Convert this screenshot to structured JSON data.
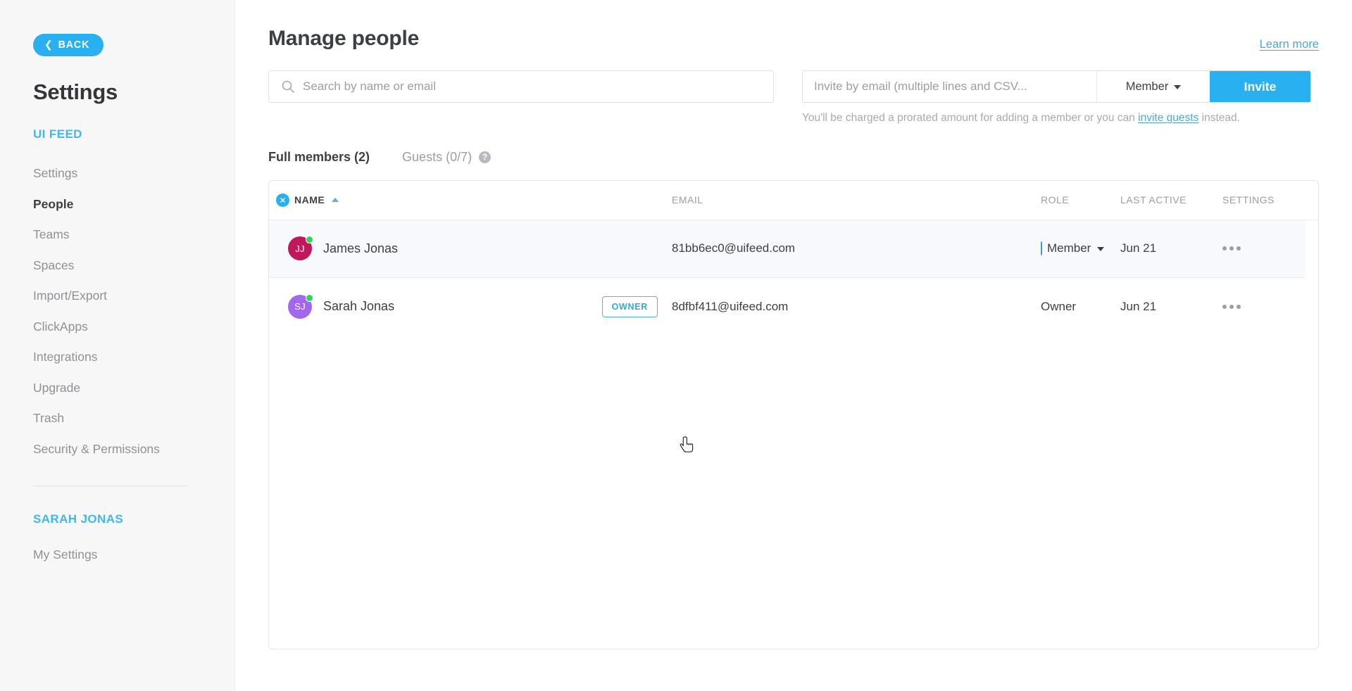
{
  "sidebar": {
    "back_label": "BACK",
    "back_icon": "chevron-left-icon",
    "title": "Settings",
    "workspace_label": "UI FEED",
    "items": [
      {
        "label": "Settings",
        "active": false
      },
      {
        "label": "People",
        "active": true
      },
      {
        "label": "Teams",
        "active": false
      },
      {
        "label": "Spaces",
        "active": false
      },
      {
        "label": "Import/Export",
        "active": false
      },
      {
        "label": "ClickApps",
        "active": false
      },
      {
        "label": "Integrations",
        "active": false
      },
      {
        "label": "Upgrade",
        "active": false
      },
      {
        "label": "Trash",
        "active": false
      },
      {
        "label": "Security & Permissions",
        "active": false
      }
    ],
    "user_label": "SARAH JONAS",
    "my_settings_label": "My Settings"
  },
  "header": {
    "title": "Manage people",
    "learn_more_label": "Learn more"
  },
  "search": {
    "placeholder": "Search by name or email",
    "value": "",
    "icon": "search-icon"
  },
  "invite": {
    "placeholder": "Invite by email (multiple lines and CSV...",
    "value": "",
    "role_label": "Member",
    "button_label": "Invite",
    "note_prefix": "You'll be charged a prorated amount for adding a member or you can ",
    "note_link": "invite guests",
    "note_suffix": " instead."
  },
  "tabs": [
    {
      "label": "Full members (2)",
      "active": true
    },
    {
      "label": "Guests (0/7)",
      "active": false,
      "help_icon": "question-mark-icon"
    }
  ],
  "table": {
    "columns": {
      "name": "NAME",
      "email": "EMAIL",
      "role": "ROLE",
      "last_active": "LAST ACTIVE",
      "settings": "SETTINGS"
    },
    "sort": {
      "column": "NAME",
      "direction": "asc",
      "clear_icon": "close-circle-icon"
    },
    "rows": [
      {
        "initials": "JJ",
        "avatar_color": "#c2185b",
        "name": "James Jonas",
        "badge": "",
        "email": "81bb6ec0@uifeed.com",
        "role": "Member",
        "role_editable": true,
        "last_active": "Jun 21",
        "settings_icon": "more-horizontal-icon",
        "online": true,
        "highlighted": true
      },
      {
        "initials": "SJ",
        "avatar_color": "#a367ed",
        "name": "Sarah Jonas",
        "badge": "OWNER",
        "email": "8dfbf411@uifeed.com",
        "role": "Owner",
        "role_editable": false,
        "last_active": "Jun 21",
        "settings_icon": "more-horizontal-icon",
        "online": true,
        "highlighted": false
      }
    ]
  },
  "colors": {
    "accent": "#28b0f0",
    "link": "#4aa8d8",
    "text": "#3c3f44",
    "muted": "#9b9ea3",
    "online": "#2fd35e"
  }
}
